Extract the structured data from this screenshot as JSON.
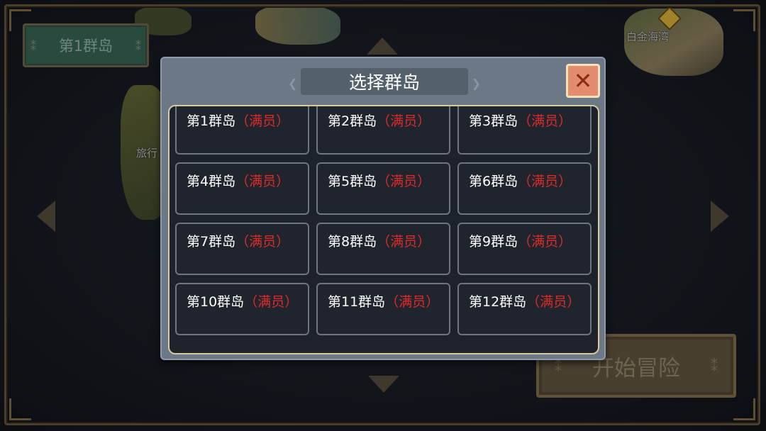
{
  "background": {
    "current_island": "第1群岛",
    "map_labels": {
      "travel": "旅行",
      "bay": "白金海湾"
    },
    "start_button_label": "开始冒险"
  },
  "modal": {
    "title": "选择群岛",
    "close_icon": "close-x-icon",
    "islands": [
      {
        "name": "第1群岛",
        "status": "（满员）"
      },
      {
        "name": "第2群岛",
        "status": "（满员）"
      },
      {
        "name": "第3群岛",
        "status": "（满员）"
      },
      {
        "name": "第4群岛",
        "status": "（满员）"
      },
      {
        "name": "第5群岛",
        "status": "（满员）"
      },
      {
        "name": "第6群岛",
        "status": "（满员）"
      },
      {
        "name": "第7群岛",
        "status": "（满员）"
      },
      {
        "name": "第8群岛",
        "status": "（满员）"
      },
      {
        "name": "第9群岛",
        "status": "（满员）"
      },
      {
        "name": "第10群岛",
        "status": "（满员）"
      },
      {
        "name": "第11群岛",
        "status": "（满员）"
      },
      {
        "name": "第12群岛",
        "status": "（满员）"
      }
    ]
  },
  "colors": {
    "full_status": "#e02a2a",
    "close_button": "#e48c6e",
    "island_tag": "#3c6d5b"
  }
}
